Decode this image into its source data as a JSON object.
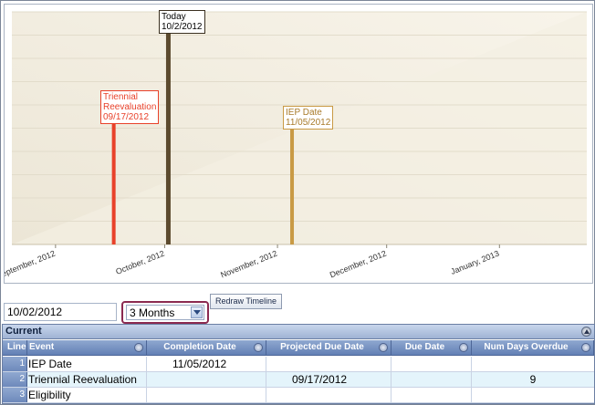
{
  "chart": {
    "x_ticks": [
      "September, 2012",
      "October, 2012",
      "November, 2012",
      "December, 2012",
      "January, 2013"
    ],
    "events": [
      {
        "title": "Triennial",
        "title2": "Reevaluation",
        "date": "09/17/2012",
        "color": "#e8412a"
      },
      {
        "title": "Today",
        "title2": "",
        "date": "10/2/2012",
        "color": "#5c4a2e"
      },
      {
        "title": "IEP Date",
        "title2": "",
        "date": "11/05/2012",
        "color": "#c99a45"
      }
    ]
  },
  "controls": {
    "date_value": "10/02/2012",
    "range_selected": "3 Months",
    "redraw_label": "Redraw Timeline"
  },
  "grid": {
    "section_title": "Current",
    "columns": [
      "Line",
      "Event",
      "Completion Date",
      "Projected Due Date",
      "Due Date",
      "Num Days Overdue"
    ],
    "rows": [
      {
        "line": "1",
        "event": "IEP Date",
        "completion": "11/05/2012",
        "projected": "",
        "due": "",
        "overdue": ""
      },
      {
        "line": "2",
        "event": "Triennial Reevaluation",
        "completion": "",
        "projected": "09/17/2012",
        "due": "",
        "overdue": "9"
      },
      {
        "line": "3",
        "event": "Eligibility",
        "completion": "",
        "projected": "",
        "due": "",
        "overdue": ""
      }
    ]
  }
}
